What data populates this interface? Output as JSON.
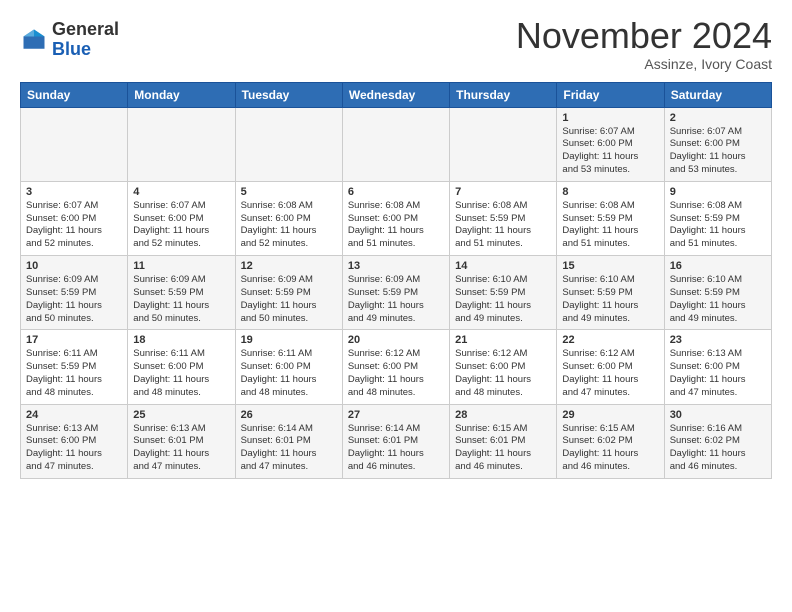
{
  "header": {
    "logo_general": "General",
    "logo_blue": "Blue",
    "month_title": "November 2024",
    "location": "Assinze, Ivory Coast"
  },
  "weekdays": [
    "Sunday",
    "Monday",
    "Tuesday",
    "Wednesday",
    "Thursday",
    "Friday",
    "Saturday"
  ],
  "weeks": [
    [
      {
        "day": "",
        "info": ""
      },
      {
        "day": "",
        "info": ""
      },
      {
        "day": "",
        "info": ""
      },
      {
        "day": "",
        "info": ""
      },
      {
        "day": "",
        "info": ""
      },
      {
        "day": "1",
        "info": "Sunrise: 6:07 AM\nSunset: 6:00 PM\nDaylight: 11 hours\nand 53 minutes."
      },
      {
        "day": "2",
        "info": "Sunrise: 6:07 AM\nSunset: 6:00 PM\nDaylight: 11 hours\nand 53 minutes."
      }
    ],
    [
      {
        "day": "3",
        "info": "Sunrise: 6:07 AM\nSunset: 6:00 PM\nDaylight: 11 hours\nand 52 minutes."
      },
      {
        "day": "4",
        "info": "Sunrise: 6:07 AM\nSunset: 6:00 PM\nDaylight: 11 hours\nand 52 minutes."
      },
      {
        "day": "5",
        "info": "Sunrise: 6:08 AM\nSunset: 6:00 PM\nDaylight: 11 hours\nand 52 minutes."
      },
      {
        "day": "6",
        "info": "Sunrise: 6:08 AM\nSunset: 6:00 PM\nDaylight: 11 hours\nand 51 minutes."
      },
      {
        "day": "7",
        "info": "Sunrise: 6:08 AM\nSunset: 5:59 PM\nDaylight: 11 hours\nand 51 minutes."
      },
      {
        "day": "8",
        "info": "Sunrise: 6:08 AM\nSunset: 5:59 PM\nDaylight: 11 hours\nand 51 minutes."
      },
      {
        "day": "9",
        "info": "Sunrise: 6:08 AM\nSunset: 5:59 PM\nDaylight: 11 hours\nand 51 minutes."
      }
    ],
    [
      {
        "day": "10",
        "info": "Sunrise: 6:09 AM\nSunset: 5:59 PM\nDaylight: 11 hours\nand 50 minutes."
      },
      {
        "day": "11",
        "info": "Sunrise: 6:09 AM\nSunset: 5:59 PM\nDaylight: 11 hours\nand 50 minutes."
      },
      {
        "day": "12",
        "info": "Sunrise: 6:09 AM\nSunset: 5:59 PM\nDaylight: 11 hours\nand 50 minutes."
      },
      {
        "day": "13",
        "info": "Sunrise: 6:09 AM\nSunset: 5:59 PM\nDaylight: 11 hours\nand 49 minutes."
      },
      {
        "day": "14",
        "info": "Sunrise: 6:10 AM\nSunset: 5:59 PM\nDaylight: 11 hours\nand 49 minutes."
      },
      {
        "day": "15",
        "info": "Sunrise: 6:10 AM\nSunset: 5:59 PM\nDaylight: 11 hours\nand 49 minutes."
      },
      {
        "day": "16",
        "info": "Sunrise: 6:10 AM\nSunset: 5:59 PM\nDaylight: 11 hours\nand 49 minutes."
      }
    ],
    [
      {
        "day": "17",
        "info": "Sunrise: 6:11 AM\nSunset: 5:59 PM\nDaylight: 11 hours\nand 48 minutes."
      },
      {
        "day": "18",
        "info": "Sunrise: 6:11 AM\nSunset: 6:00 PM\nDaylight: 11 hours\nand 48 minutes."
      },
      {
        "day": "19",
        "info": "Sunrise: 6:11 AM\nSunset: 6:00 PM\nDaylight: 11 hours\nand 48 minutes."
      },
      {
        "day": "20",
        "info": "Sunrise: 6:12 AM\nSunset: 6:00 PM\nDaylight: 11 hours\nand 48 minutes."
      },
      {
        "day": "21",
        "info": "Sunrise: 6:12 AM\nSunset: 6:00 PM\nDaylight: 11 hours\nand 48 minutes."
      },
      {
        "day": "22",
        "info": "Sunrise: 6:12 AM\nSunset: 6:00 PM\nDaylight: 11 hours\nand 47 minutes."
      },
      {
        "day": "23",
        "info": "Sunrise: 6:13 AM\nSunset: 6:00 PM\nDaylight: 11 hours\nand 47 minutes."
      }
    ],
    [
      {
        "day": "24",
        "info": "Sunrise: 6:13 AM\nSunset: 6:00 PM\nDaylight: 11 hours\nand 47 minutes."
      },
      {
        "day": "25",
        "info": "Sunrise: 6:13 AM\nSunset: 6:01 PM\nDaylight: 11 hours\nand 47 minutes."
      },
      {
        "day": "26",
        "info": "Sunrise: 6:14 AM\nSunset: 6:01 PM\nDaylight: 11 hours\nand 47 minutes."
      },
      {
        "day": "27",
        "info": "Sunrise: 6:14 AM\nSunset: 6:01 PM\nDaylight: 11 hours\nand 46 minutes."
      },
      {
        "day": "28",
        "info": "Sunrise: 6:15 AM\nSunset: 6:01 PM\nDaylight: 11 hours\nand 46 minutes."
      },
      {
        "day": "29",
        "info": "Sunrise: 6:15 AM\nSunset: 6:02 PM\nDaylight: 11 hours\nand 46 minutes."
      },
      {
        "day": "30",
        "info": "Sunrise: 6:16 AM\nSunset: 6:02 PM\nDaylight: 11 hours\nand 46 minutes."
      }
    ]
  ]
}
